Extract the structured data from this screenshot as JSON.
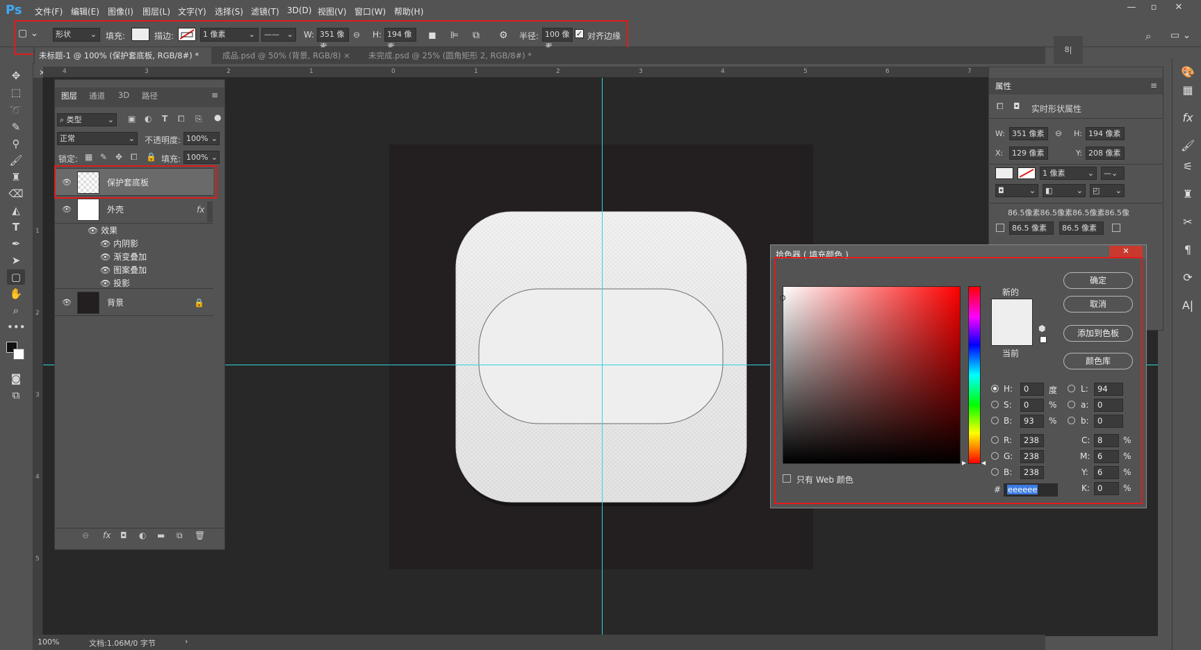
{
  "app": {
    "logo": "Ps"
  },
  "menu": [
    "文件(F)",
    "编辑(E)",
    "图像(I)",
    "图层(L)",
    "文字(Y)",
    "选择(S)",
    "滤镜(T)",
    "3D(D)",
    "视图(V)",
    "窗口(W)",
    "帮助(H)"
  ],
  "options": {
    "mode": "形状",
    "fill_label": "填充:",
    "stroke_label": "描边:",
    "stroke_width": "1 像素",
    "w_label": "W:",
    "w_value": "351 像素",
    "h_label": "H:",
    "h_value": "194 像素",
    "radius_label": "半径:",
    "radius_value": "100 像素",
    "align_edges": "对齐边缘"
  },
  "tabs": [
    {
      "label": "未标题-1 @ 100% (保护套底板, RGB/8#) *",
      "close": "×"
    },
    {
      "label": "成品.psd @ 50% (背景, RGB/8)",
      "close": "×"
    },
    {
      "label": "未完成.psd @ 25% (圆角矩形 2, RGB/8#) *",
      "close": "×"
    }
  ],
  "ruler_top": [
    "4",
    "3",
    "2",
    "1",
    "0",
    "1",
    "2",
    "3",
    "4",
    "5",
    "6",
    "7"
  ],
  "ruler_left": [
    "1",
    "2",
    "3",
    "4",
    "5"
  ],
  "layers_panel": {
    "tabs": [
      "图层",
      "通道",
      "3D",
      "路径"
    ],
    "filter": "类型",
    "blend_mode": "正常",
    "opacity_label": "不透明度:",
    "opacity_value": "100%",
    "lock_label": "锁定:",
    "fill_label": "填充:",
    "fill_value": "100%",
    "layers": [
      {
        "name": "保护套底板"
      },
      {
        "name": "外壳",
        "fx": "fx"
      },
      {
        "name": "背景"
      }
    ],
    "effects_label": "效果",
    "effects": [
      "内阴影",
      "渐变叠加",
      "图案叠加",
      "投影"
    ]
  },
  "properties_panel": {
    "title": "属性",
    "subtitle": "实时形状属性",
    "w_label": "W:",
    "w": "351 像素",
    "h_label": "H:",
    "h": "194 像素",
    "x_label": "X:",
    "x": "129 像素",
    "y_label": "Y:",
    "y": "208 像素",
    "stroke": "1 像素",
    "corners": "86.5像素86.5像素86.5像素86.5像",
    "corner_a": "86.5 像素",
    "corner_b": "86.5 像素",
    "mini_label": "8|"
  },
  "color_picker": {
    "title": "拾色器 ( 填充颜色 )",
    "new_label": "新的",
    "current_label": "当前",
    "ok": "确定",
    "cancel": "取消",
    "add_swatch": "添加到色板",
    "libraries": "颜色库",
    "web_only": "只有 Web 颜色",
    "H": "0",
    "S": "0",
    "B": "93",
    "R": "238",
    "G": "238",
    "B2": "238",
    "L": "94",
    "a": "0",
    "b": "0",
    "C": "8",
    "M": "6",
    "Y": "6",
    "K": "0",
    "deg": "度",
    "pct": "%",
    "hex_label": "#",
    "hex": "eeeeee",
    "colors": {
      "new": "#eeeeee",
      "current": "#eeeeee",
      "hue": "#ff0000"
    }
  },
  "status": {
    "zoom": "100%",
    "doc": "文档:1.06M/0 字节",
    "arrow": "›"
  }
}
